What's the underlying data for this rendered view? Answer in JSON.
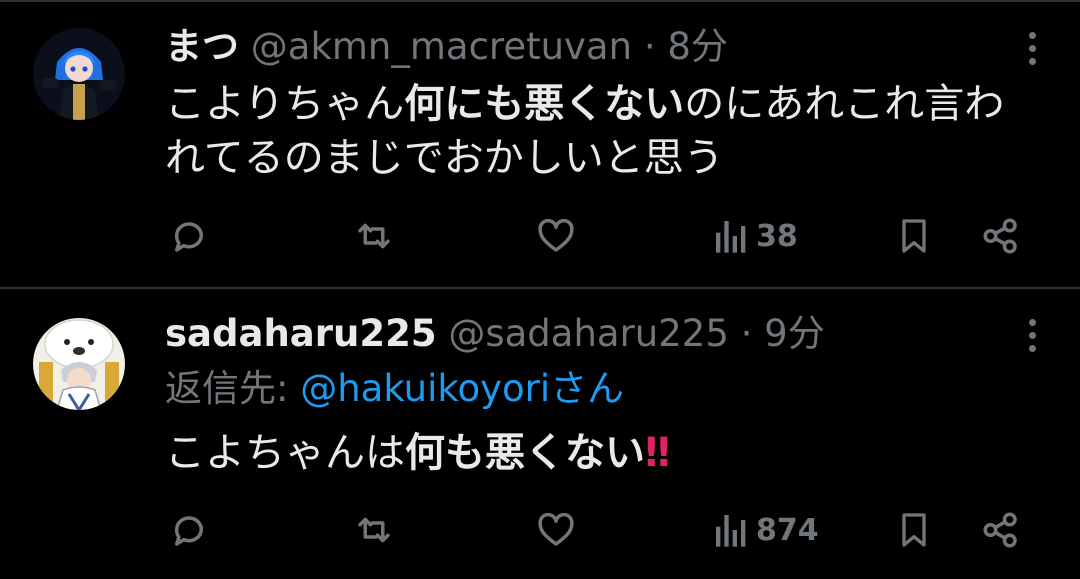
{
  "tweets": [
    {
      "name": "まつ",
      "handle": "@akmn_macretuvan",
      "dot": "·",
      "time": "8分",
      "body": {
        "line1_a": "こよりちゃん",
        "line1_b": "何にも悪くない",
        "line1_c": "のにあれこれ言わ",
        "line2": "れてるのまじでおかしいと思う"
      },
      "views": "38"
    },
    {
      "name": "sadaharu225",
      "handle": "@sadaharu225",
      "dot": "·",
      "time": "9分",
      "reply_label": "返信先: ",
      "reply_mention": "@hakuikoyori",
      "reply_suffix": "さん",
      "body": {
        "a": "こよちゃんは",
        "b": "何も悪くない",
        "c": "‼"
      },
      "views": "874"
    }
  ],
  "icons": [
    "reply-icon",
    "retweet-icon",
    "like-icon",
    "views-icon",
    "bookmark-icon",
    "share-icon",
    "more-icon"
  ],
  "colors": {
    "background": "#000000",
    "text": "#e7e9ea",
    "muted": "#71767b",
    "link": "#1d9bf0",
    "accent_red": "#e0245e"
  }
}
